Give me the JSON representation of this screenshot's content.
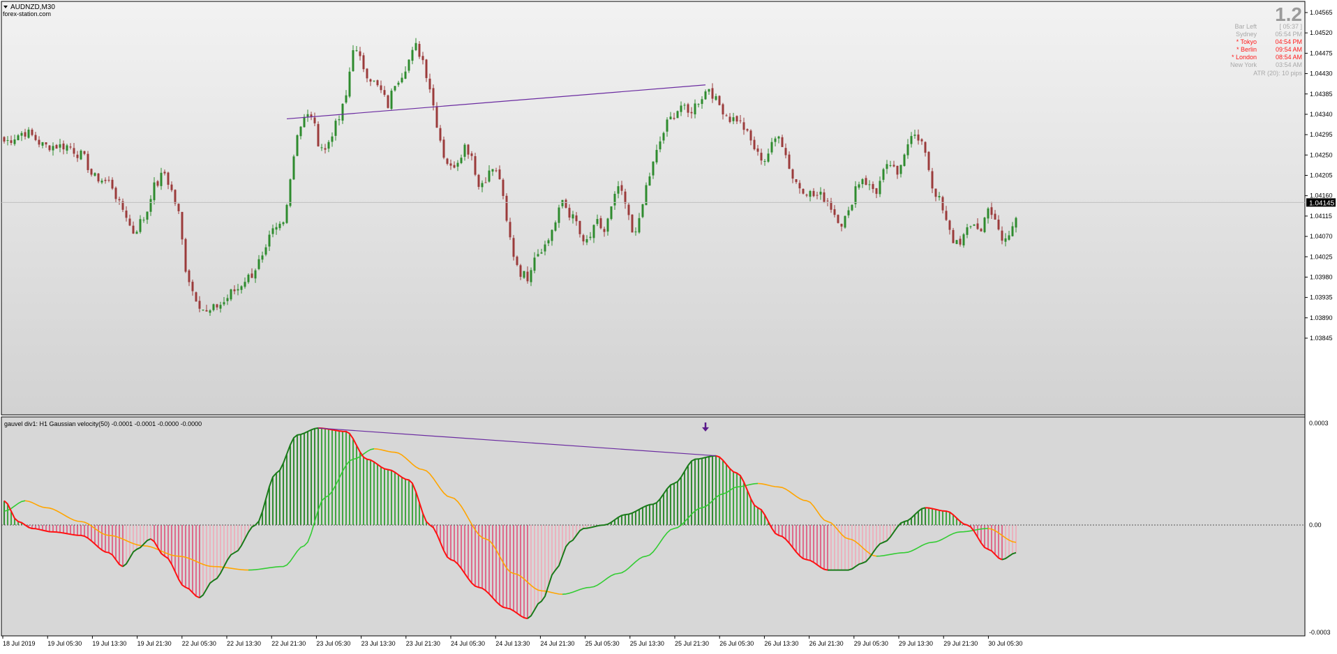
{
  "window": {
    "symbol_label": "AUDNZD,M30",
    "site": "forex-station.com",
    "big_value": "1.2"
  },
  "session_panel": {
    "rows": [
      {
        "label": "Bar Left",
        "value": "[ 05:37 ]",
        "color": "#a8a8a8"
      },
      {
        "label": "Sydney",
        "value": "05:54 PM",
        "color": "#a8a8a8"
      },
      {
        "label": "* Tokyo",
        "value": "04:54 PM",
        "color": "#ff1a1a"
      },
      {
        "label": "* Berlin",
        "value": "09:54 AM",
        "color": "#ff1a1a"
      },
      {
        "label": "* London",
        "value": "08:54 AM",
        "color": "#ff1a1a"
      },
      {
        "label": "New York",
        "value": "03:54 AM",
        "color": "#a8a8a8"
      }
    ],
    "atr_label": "ATR (20): 10 pips"
  },
  "indicator": {
    "title": "gauvel div1: H1  Gaussian velocity(50) -0.0001 -0.0001 -0.0000 -0.0000",
    "zero_label": "0.00",
    "top_label": "0.0003",
    "bottom_label": "-0.0003"
  },
  "colors": {
    "bull_candle": "#2e8b2e",
    "bear_candle": "#9b3b3b",
    "divergence_line": "#6a2aa0",
    "red_line": "#ff1111",
    "dark_green_line": "#1a7a1a",
    "light_green_line": "#33cc33",
    "orange_line": "#ffa500",
    "hist_green_strong": "#0a7a0a",
    "hist_green_light": "#1e9a1e",
    "hist_pink_strong": "#e0507a",
    "hist_pink_light": "#f0a8b8",
    "arrow": "#5a1a8a",
    "current_price_bg": "#000000"
  },
  "chart_data": [
    {
      "type": "candlestick",
      "symbol": "AUDNZD",
      "timeframe": "M30",
      "y_ticks": [
        "1.04565",
        "1.04520",
        "1.04475",
        "1.04430",
        "1.04385",
        "1.04340",
        "1.04295",
        "1.04250",
        "1.04205",
        "1.04160",
        "1.04115",
        "1.04070",
        "1.04025",
        "1.03980",
        "1.03935",
        "1.03890",
        "1.03845"
      ],
      "ylim": [
        1.03845,
        1.04565
      ],
      "current_price": "1.04145",
      "x_ticks": [
        "18 Jul 2019",
        "19 Jul 05:30",
        "19 Jul 13:30",
        "19 Jul 21:30",
        "22 Jul 05:30",
        "22 Jul 13:30",
        "22 Jul 21:30",
        "23 Jul 05:30",
        "23 Jul 13:30",
        "23 Jul 21:30",
        "24 Jul 05:30",
        "24 Jul 13:30",
        "24 Jul 21:30",
        "25 Jul 05:30",
        "25 Jul 13:30",
        "25 Jul 21:30",
        "26 Jul 05:30",
        "26 Jul 13:30",
        "26 Jul 21:30",
        "29 Jul 05:30",
        "29 Jul 13:30",
        "29 Jul 21:30",
        "30 Jul 05:30"
      ],
      "close_path": [
        [
          0,
          1.0428
        ],
        [
          6,
          1.043
        ],
        [
          12,
          1.0427
        ],
        [
          18,
          1.0427
        ],
        [
          22,
          1.0425
        ],
        [
          26,
          1.042
        ],
        [
          30,
          1.0419
        ],
        [
          34,
          1.0413
        ],
        [
          37,
          1.0408
        ],
        [
          40,
          1.0411
        ],
        [
          43,
          1.0418
        ],
        [
          46,
          1.0421
        ],
        [
          48,
          1.0417
        ],
        [
          50,
          1.0412
        ],
        [
          52,
          1.04
        ],
        [
          54,
          1.0395
        ],
        [
          56,
          1.0392
        ],
        [
          58,
          1.039
        ],
        [
          62,
          1.0392
        ],
        [
          66,
          1.0395
        ],
        [
          70,
          1.0398
        ],
        [
          74,
          1.0402
        ],
        [
          77,
          1.0408
        ],
        [
          80,
          1.041
        ],
        [
          82,
          1.042
        ],
        [
          84,
          1.043
        ],
        [
          86,
          1.0433
        ],
        [
          88,
          1.0434
        ],
        [
          90,
          1.0428
        ],
        [
          92,
          1.0426
        ],
        [
          94,
          1.043
        ],
        [
          96,
          1.0433
        ],
        [
          98,
          1.0438
        ],
        [
          100,
          1.0449
        ],
        [
          102,
          1.0446
        ],
        [
          104,
          1.0443
        ],
        [
          106,
          1.0441
        ],
        [
          108,
          1.0439
        ],
        [
          110,
          1.0436
        ],
        [
          112,
          1.0441
        ],
        [
          114,
          1.0443
        ],
        [
          116,
          1.0446
        ],
        [
          118,
          1.0449
        ],
        [
          120,
          1.0446
        ],
        [
          122,
          1.044
        ],
        [
          124,
          1.0432
        ],
        [
          126,
          1.0425
        ],
        [
          128,
          1.0422
        ],
        [
          130,
          1.0424
        ],
        [
          132,
          1.0427
        ],
        [
          134,
          1.0425
        ],
        [
          136,
          1.0418
        ],
        [
          138,
          1.042
        ],
        [
          140,
          1.0422
        ],
        [
          142,
          1.042
        ],
        [
          144,
          1.041
        ],
        [
          146,
          1.0403
        ],
        [
          148,
          1.0399
        ],
        [
          150,
          1.0398
        ],
        [
          152,
          1.0403
        ],
        [
          155,
          1.0405
        ],
        [
          158,
          1.041
        ],
        [
          160,
          1.0415
        ],
        [
          162,
          1.0412
        ],
        [
          164,
          1.041
        ],
        [
          166,
          1.0405
        ],
        [
          168,
          1.0407
        ],
        [
          170,
          1.041
        ],
        [
          172,
          1.0408
        ],
        [
          174,
          1.0413
        ],
        [
          176,
          1.0418
        ],
        [
          178,
          1.0414
        ],
        [
          180,
          1.0408
        ],
        [
          182,
          1.041
        ],
        [
          184,
          1.0418
        ],
        [
          186,
          1.0423
        ],
        [
          188,
          1.0428
        ],
        [
          190,
          1.0432
        ],
        [
          192,
          1.0434
        ],
        [
          194,
          1.0436
        ],
        [
          196,
          1.0434
        ],
        [
          198,
          1.0436
        ],
        [
          200,
          1.0438
        ],
        [
          202,
          1.044
        ],
        [
          204,
          1.0437
        ],
        [
          206,
          1.0435
        ],
        [
          208,
          1.0433
        ],
        [
          210,
          1.0433
        ],
        [
          212,
          1.0431
        ],
        [
          214,
          1.0428
        ],
        [
          216,
          1.0425
        ],
        [
          218,
          1.0424
        ],
        [
          220,
          1.0427
        ],
        [
          222,
          1.043
        ],
        [
          224,
          1.0425
        ],
        [
          226,
          1.042
        ],
        [
          228,
          1.0418
        ],
        [
          230,
          1.0417
        ],
        [
          232,
          1.0416
        ],
        [
          234,
          1.0416
        ],
        [
          236,
          1.0415
        ],
        [
          238,
          1.0412
        ],
        [
          240,
          1.041
        ],
        [
          242,
          1.0412
        ],
        [
          244,
          1.0418
        ],
        [
          246,
          1.042
        ],
        [
          248,
          1.0418
        ],
        [
          250,
          1.0417
        ],
        [
          252,
          1.0421
        ],
        [
          254,
          1.0423
        ],
        [
          256,
          1.042
        ],
        [
          258,
          1.0426
        ],
        [
          260,
          1.043
        ],
        [
          262,
          1.0428
        ],
        [
          264,
          1.0426
        ],
        [
          266,
          1.0418
        ],
        [
          268,
          1.0415
        ],
        [
          270,
          1.041
        ],
        [
          272,
          1.0406
        ],
        [
          274,
          1.0406
        ],
        [
          276,
          1.0408
        ],
        [
          278,
          1.041
        ],
        [
          280,
          1.0408
        ],
        [
          282,
          1.0414
        ],
        [
          284,
          1.041
        ],
        [
          286,
          1.0406
        ],
        [
          288,
          1.0407
        ],
        [
          290,
          1.0412
        ]
      ]
    },
    {
      "type": "line",
      "title": "gauvel div1: H1  Gaussian velocity(50)",
      "ylim": [
        -0.0003,
        0.0003
      ],
      "y_ticks": [
        "0.0003",
        "0.00",
        "-0.0003"
      ],
      "series": [
        {
          "role": "velocity",
          "color_up": "#1a7a1a",
          "color_down": "#ff1111",
          "points": [
            [
              0,
              7e-05
            ],
            [
              4,
              1e-05
            ],
            [
              8,
              -1e-05
            ],
            [
              14,
              -2e-05
            ],
            [
              22,
              -3e-05
            ],
            [
              30,
              -8e-05
            ],
            [
              34,
              -0.00012
            ],
            [
              38,
              -7e-05
            ],
            [
              42,
              -4e-05
            ],
            [
              46,
              -9e-05
            ],
            [
              52,
              -0.00018
            ],
            [
              56,
              -0.00021
            ],
            [
              60,
              -0.00016
            ],
            [
              66,
              -8e-05
            ],
            [
              72,
              0.0
            ],
            [
              78,
              0.00015
            ],
            [
              84,
              0.00026
            ],
            [
              90,
              0.00028
            ],
            [
              98,
              0.00027
            ],
            [
              104,
              0.00019
            ],
            [
              110,
              0.00016
            ],
            [
              116,
              0.00013
            ],
            [
              122,
              0.0
            ],
            [
              128,
              -0.0001
            ],
            [
              136,
              -0.00018
            ],
            [
              144,
              -0.00024
            ],
            [
              150,
              -0.00027
            ],
            [
              154,
              -0.00022
            ],
            [
              158,
              -0.00013
            ],
            [
              162,
              -5e-05
            ],
            [
              166,
              -1e-05
            ],
            [
              172,
              0.0
            ],
            [
              178,
              3e-05
            ],
            [
              186,
              6e-05
            ],
            [
              192,
              0.00012
            ],
            [
              198,
              0.00019
            ],
            [
              204,
              0.0002
            ],
            [
              210,
              0.00015
            ],
            [
              216,
              5e-05
            ],
            [
              222,
              -3e-05
            ],
            [
              230,
              -0.0001
            ],
            [
              236,
              -0.00013
            ],
            [
              242,
              -0.00013
            ],
            [
              246,
              -0.00011
            ],
            [
              252,
              -5e-05
            ],
            [
              258,
              1e-05
            ],
            [
              264,
              5e-05
            ],
            [
              270,
              4e-05
            ],
            [
              276,
              0.0
            ],
            [
              282,
              -7e-05
            ],
            [
              286,
              -0.0001
            ],
            [
              290,
              -8e-05
            ]
          ]
        },
        {
          "role": "signal",
          "color_up": "#33cc33",
          "color_down": "#ffa500",
          "points": [
            [
              0,
              4e-05
            ],
            [
              6,
              7e-05
            ],
            [
              12,
              5e-05
            ],
            [
              22,
              1e-05
            ],
            [
              30,
              -3e-05
            ],
            [
              40,
              -6e-05
            ],
            [
              50,
              -9e-05
            ],
            [
              60,
              -0.00012
            ],
            [
              70,
              -0.00013
            ],
            [
              80,
              -0.00012
            ],
            [
              86,
              -6e-05
            ],
            [
              92,
              8e-05
            ],
            [
              100,
              0.00019
            ],
            [
              106,
              0.00022
            ],
            [
              112,
              0.00021
            ],
            [
              120,
              0.00016
            ],
            [
              128,
              8e-05
            ],
            [
              138,
              -4e-05
            ],
            [
              146,
              -0.00014
            ],
            [
              154,
              -0.00019
            ],
            [
              160,
              -0.0002
            ],
            [
              168,
              -0.00018
            ],
            [
              176,
              -0.00014
            ],
            [
              184,
              -9e-05
            ],
            [
              192,
              -1e-05
            ],
            [
              200,
              5e-05
            ],
            [
              206,
              9e-05
            ],
            [
              210,
              0.00011
            ],
            [
              216,
              0.00012
            ],
            [
              222,
              0.00011
            ],
            [
              230,
              7e-05
            ],
            [
              236,
              1e-05
            ],
            [
              242,
              -4e-05
            ],
            [
              250,
              -9e-05
            ],
            [
              258,
              -8e-05
            ],
            [
              266,
              -5e-05
            ],
            [
              274,
              -2e-05
            ],
            [
              282,
              -1e-05
            ],
            [
              290,
              -5e-05
            ]
          ]
        }
      ],
      "annotations": [
        {
          "kind": "divergence_arrow",
          "direction": "down",
          "bar": 201
        }
      ]
    }
  ]
}
